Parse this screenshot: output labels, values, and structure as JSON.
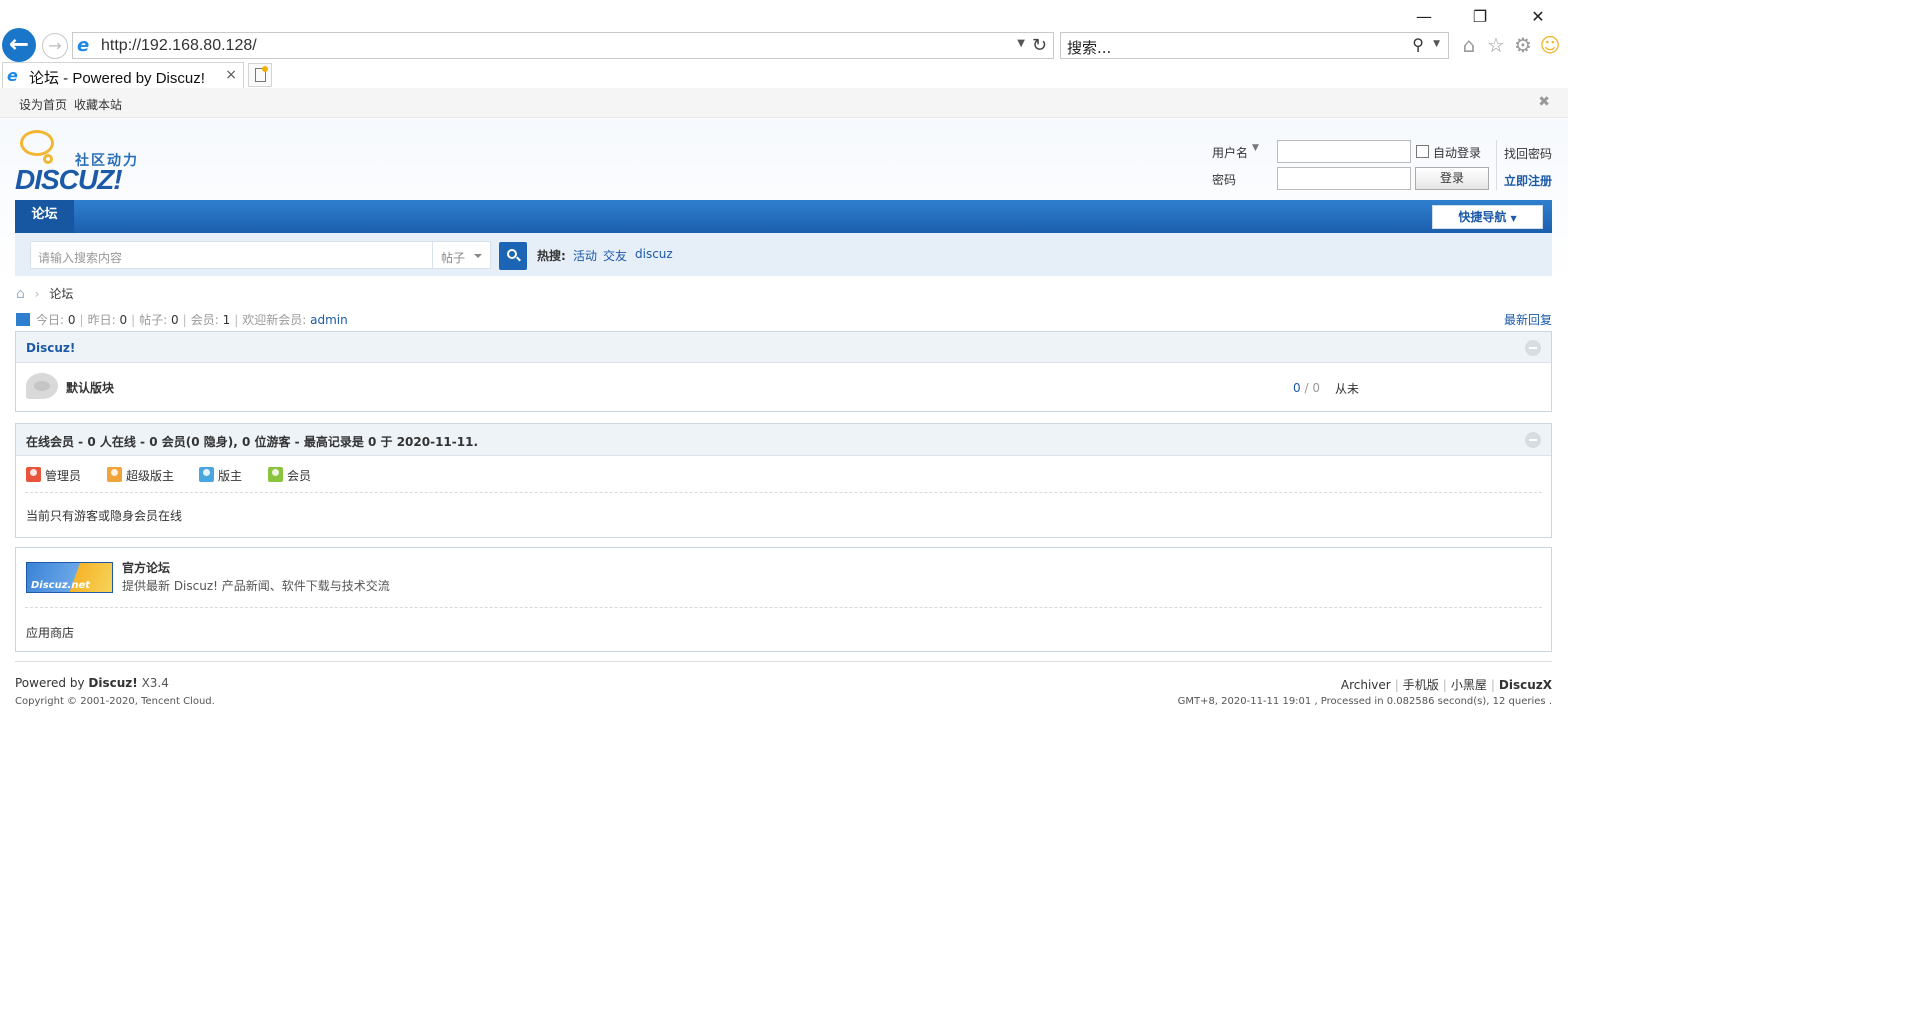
{
  "browser": {
    "url": "http://192.168.80.128/",
    "search_placeholder": "搜索...",
    "tab_title": "论坛 - Powered by Discuz!",
    "tab_close": "×"
  },
  "topbar": {
    "set_home": "设为首页",
    "bookmark": "收藏本站"
  },
  "logo": {
    "subtitle": "社区动力",
    "word": "DISCUZ!"
  },
  "login": {
    "username_label": "用户名",
    "password_label": "密码",
    "auto_login": "自动登录",
    "login_button": "登录",
    "forgot": "找回密码",
    "register": "立即注册"
  },
  "nav": {
    "current": "论坛",
    "quick_nav": "快捷导航"
  },
  "search": {
    "placeholder": "请输入搜索内容",
    "type": "帖子",
    "hot_label": "热搜:",
    "hot": [
      "活动",
      "交友",
      "discuz"
    ]
  },
  "breadcrumb": {
    "current": "论坛"
  },
  "stats": {
    "today_label": "今日:",
    "today": "0",
    "yesterday_label": "昨日:",
    "yesterday": "0",
    "posts_label": "帖子:",
    "posts": "0",
    "members_label": "会员:",
    "members": "1",
    "welcome_label": "欢迎新会员:",
    "newest": "admin",
    "latest_replies": "最新回复"
  },
  "category": {
    "title": "Discuz!",
    "forum_name": "默认版块",
    "threads": "0",
    "posts": "0",
    "last_post": "从未"
  },
  "online": {
    "title": "在线会员 - 0 人在线 - 0 会员(0 隐身), 0 位游客 - 最高记录是 0 于 2020-11-11.",
    "legend": [
      "管理员",
      "超级版主",
      "版主",
      "会员"
    ],
    "legend_colors": [
      "#e8553c",
      "#f1a33c",
      "#4aa6e0",
      "#8ac43f"
    ],
    "message": "当前只有游客或隐身会员在线"
  },
  "links": {
    "logo_text": "Discuz.net",
    "name": "官方论坛",
    "desc": "提供最新 Discuz! 产品新闻、软件下载与技术交流",
    "app_store": "应用商店"
  },
  "footer": {
    "powered_prefix": "Powered by",
    "powered_name": "Discuz!",
    "version": "X3.4",
    "copyright": "Copyright © 2001-2020, Tencent Cloud.",
    "links": [
      "Archiver",
      "手机版",
      "小黑屋",
      "DiscuzX"
    ],
    "processed": "GMT+8, 2020-11-11 19:01 , Processed in 0.082586 second(s), 12 queries ."
  }
}
